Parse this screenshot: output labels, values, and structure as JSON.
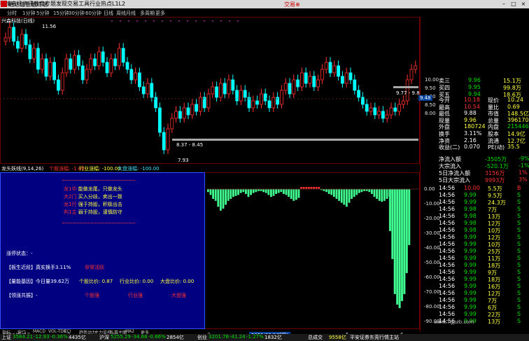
{
  "window": {
    "title": "通达信金融终端",
    "red_title": "交易⊕"
  },
  "menu": [
    "行情",
    "市场",
    "资讯",
    "教育",
    "专题",
    "发现",
    "交易",
    "工具",
    "行业",
    "热点",
    "L1L2"
  ],
  "periods": [
    "分时",
    "1分钟",
    "5分钟",
    "15分钟",
    "30分钟",
    "60分钟",
    "日线",
    "周线",
    "月线",
    "多周期",
    "更多"
  ],
  "active_period": "日线",
  "stock": {
    "name": "兴森科技(日线)",
    "high_label": "11.56",
    "low_label": "7.93",
    "box1": "8.37 - 8.45",
    "box2": "9.77 - 9.85",
    "last": "9.48"
  },
  "y_axis_main": [
    "10.00",
    "9.50",
    "9.00",
    "8.50",
    "8.00"
  ],
  "indicator": {
    "header": "龙头妖线(9,14,26)",
    "h_red": "个股涨幅: -1.00",
    "h_ind": "行业涨幅: -100.00",
    "h_mkt": "大盘涨幅: -100.00",
    "y_axis": [
      "0.00",
      "-10.00",
      "-20.00",
      "-30.00",
      "-40.00",
      "-50.00",
      "-60.00",
      "-70.00",
      "-80.00",
      "-90.00"
    ],
    "slogans": [
      {
        "k": "龙1中",
        "v": "能做龙尾，只做龙头"
      },
      {
        "k": "大2门",
        "v": "买入分歧，卖出一致"
      },
      {
        "k": "龙1行",
        "v": "强于持股，积极出击"
      },
      {
        "k": "判1主",
        "v": "弱于持股，谨慎防守"
      }
    ],
    "status_label": "涨停状态：-",
    "ratio_label": "【板生近段】真实换手3.11%",
    "ratio_tag": "非常活跃",
    "amount_label": "【量能基因】今日量39.62万",
    "stock_ratio": "个股比价: 0.87",
    "industry_ratio": "行业比价: 0.00",
    "market_ratio": "大盘比价: 0.00",
    "board_label": "【领涨共振】-",
    "tags": [
      "个股强",
      "行业强",
      "大盘强"
    ]
  },
  "quote": {
    "asks": [
      {
        "label": "卖三",
        "price": "9.96",
        "vol": "15.1万"
      },
      {
        "label": "买四",
        "price": "9.95",
        "vol": "99.8万"
      },
      {
        "label": "买五",
        "price": "9.94",
        "vol": "18.6万"
      }
    ],
    "stats": [
      {
        "k": "今开",
        "v": "10.18",
        "k2": "现价",
        "v2": "10.24"
      },
      {
        "k": "最高",
        "v": "10.54",
        "k2": "量比",
        "v2": "0.69"
      },
      {
        "k": "最低",
        "v": "9.88",
        "k2": "市值",
        "v2": "148.5亿"
      },
      {
        "k": "现量",
        "v": "9.96",
        "k2": "总量",
        "v2": "396170"
      },
      {
        "k": "外盘",
        "v": "180724",
        "k2": "内盘",
        "v2": "215446"
      },
      {
        "k": "换手",
        "v": "3.11%",
        "k2": "股本",
        "v2": "14.9亿"
      },
      {
        "k": "净资",
        "v": "2.16",
        "k2": "流通",
        "v2": "12.7亿"
      },
      {
        "k": "收益(二)",
        "v": "0.070",
        "k2": "PE(动)",
        "v2": "35.5"
      }
    ],
    "flows": [
      {
        "k": "净流入额",
        "v": "-3505万",
        "p": "-9%"
      },
      {
        "k": "大宗流入",
        "v": "-520.1万",
        "p": "-1%"
      },
      {
        "k": "5日净流入额",
        "v": "3156万",
        "p": "1%"
      },
      {
        "k": "5日大宗流入",
        "v": "9993万",
        "p": "3%"
      }
    ]
  },
  "ticks": [
    {
      "t": "14:56",
      "p": "10.00",
      "v": "5.5万",
      "c": "B"
    },
    {
      "t": "14:56",
      "p": "9.99",
      "v": "9.5万",
      "c": "S"
    },
    {
      "t": "14:56",
      "p": "9.99",
      "v": "24.3万",
      "c": "S"
    },
    {
      "t": "14:56",
      "p": "9.98",
      "v": "7万",
      "c": "S"
    },
    {
      "t": "14:56",
      "p": "9.98",
      "v": "13万",
      "c": "S"
    },
    {
      "t": "14:56",
      "p": "9.98",
      "v": "12万",
      "c": "S"
    },
    {
      "t": "14:56",
      "p": "9.98",
      "v": "10万",
      "c": "S"
    },
    {
      "t": "14:56",
      "p": "9.99",
      "v": "12万",
      "c": "S"
    },
    {
      "t": "14:56",
      "p": "9.99",
      "v": "10万",
      "c": "S"
    },
    {
      "t": "14:56",
      "p": "9.99",
      "v": "25万",
      "c": "S"
    },
    {
      "t": "14:56",
      "p": "9.99",
      "v": "11万",
      "c": "S"
    },
    {
      "t": "14:56",
      "p": "9.99",
      "v": "18万",
      "c": "S"
    },
    {
      "t": "14:56",
      "p": "9.99",
      "v": "9万",
      "c": "S"
    },
    {
      "t": "14:56",
      "p": "9.99",
      "v": "18万",
      "c": "S"
    },
    {
      "t": "14:56",
      "p": "9.99",
      "v": "16万",
      "c": "S"
    },
    {
      "t": "14:56",
      "p": "9.99",
      "v": "12万",
      "c": "S"
    },
    {
      "t": "14:56",
      "p": "9.99",
      "v": "7万",
      "c": "S"
    },
    {
      "t": "14:56",
      "p": "9.99",
      "v": "6万",
      "c": "S"
    },
    {
      "t": "14:56",
      "p": "9.99",
      "v": "22万",
      "c": "S"
    },
    {
      "t": "14:56",
      "p": "9.99",
      "v": "13万",
      "c": "S"
    }
  ],
  "time_axis": [
    "2020年",
    "12",
    "2",
    "3",
    "2021/03/18(四)",
    "4",
    "5",
    "6"
  ],
  "bottom_tabs": [
    "指标",
    "窗口",
    "MACD",
    "VOL-TDX",
    "CCI",
    "趋势动力",
    "主力监控",
    "私募主图",
    "MA2",
    "更多"
  ],
  "bottom_tabs2": [
    "扩展",
    "盘口分布",
    "资金分布",
    "综合资讯",
    "行业资讯",
    "互动问答",
    "新用户福利专享"
  ],
  "status": {
    "items": [
      {
        "name": "上证",
        "v": "3584.21",
        "d": "-12.93",
        "p": "-0.36%",
        "a": "4435亿"
      },
      {
        "name": "沪深",
        "v": "5255.29",
        "d": "-34.68",
        "p": "-0.66%",
        "a": "2854亿"
      },
      {
        "name": "创业",
        "v": "3201.78",
        "d": "-41.24",
        "p": "-1.27%",
        "a": "1832亿"
      }
    ],
    "total": "总成交",
    "total_v": "9558亿",
    "broker": "平安证券东莞行情主站",
    "f10": "数百万F10 数百"
  },
  "watermark": "www.7gpzb.com"
}
